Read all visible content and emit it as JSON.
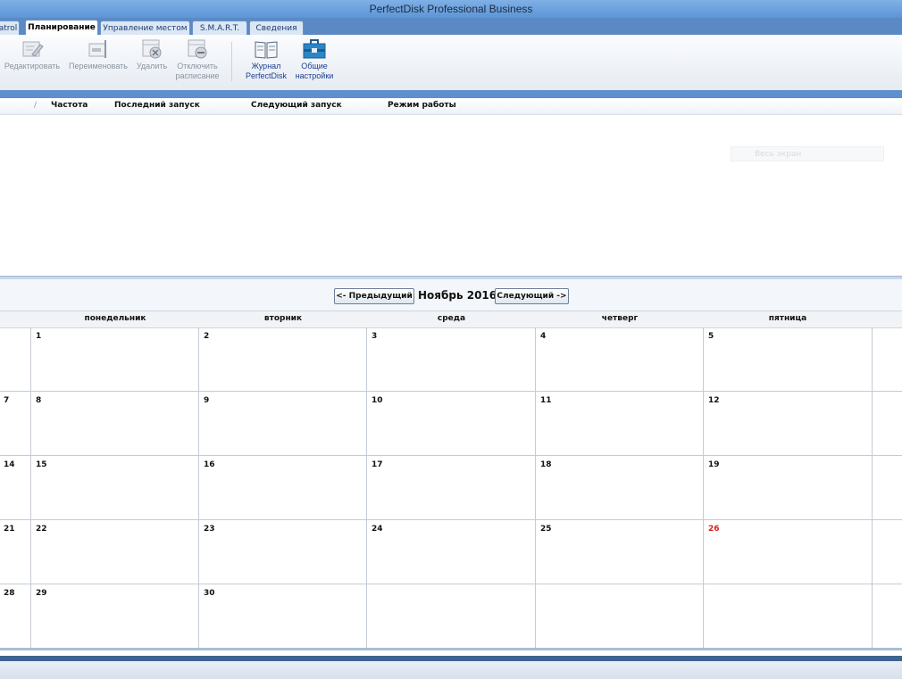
{
  "window": {
    "title": "PerfectDisk Professional Business"
  },
  "tabs": [
    {
      "label": "atrol",
      "active": false
    },
    {
      "label": "Планирование",
      "active": true
    },
    {
      "label": "Управление местом",
      "active": false
    },
    {
      "label": "S.M.A.R.T.",
      "active": false
    },
    {
      "label": "Сведения",
      "active": false
    }
  ],
  "toolbar": {
    "edit": {
      "label": "Редактировать",
      "icon": "edit-icon",
      "enabled": false
    },
    "rename": {
      "label": "Переименовать",
      "icon": "rename-icon",
      "enabled": false
    },
    "delete": {
      "label": "Удалить",
      "icon": "delete-icon",
      "enabled": false
    },
    "disable_l1": "Отключить",
    "disable_l2": "расписание",
    "journal_l1": "Журнал",
    "journal_l2": "PerfectDisk",
    "settings_l1": "Общие",
    "settings_l2": "настройки"
  },
  "list": {
    "sort_glyph": "/",
    "columns": [
      "Частота",
      "Последний запуск",
      "Следующий запуск",
      "Режим работы"
    ],
    "ghost_text": "Весь экран"
  },
  "calendar": {
    "prev_label": "<- Предыдущий",
    "next_label": "Следующий ->",
    "month_label": "Ноябрь 2016",
    "weekdays": [
      "понедельник",
      "вторник",
      "среда",
      "четверг",
      "пятница"
    ],
    "weeks": [
      [
        "",
        "1",
        "2",
        "3",
        "4",
        "5"
      ],
      [
        "7",
        "8",
        "9",
        "10",
        "11",
        "12"
      ],
      [
        "14",
        "15",
        "16",
        "17",
        "18",
        "19"
      ],
      [
        "21",
        "22",
        "23",
        "24",
        "25",
        "26"
      ],
      [
        "28",
        "29",
        "30",
        "",
        "",
        ""
      ]
    ],
    "highlight_day": "26",
    "highlight_color": "#d62020"
  }
}
